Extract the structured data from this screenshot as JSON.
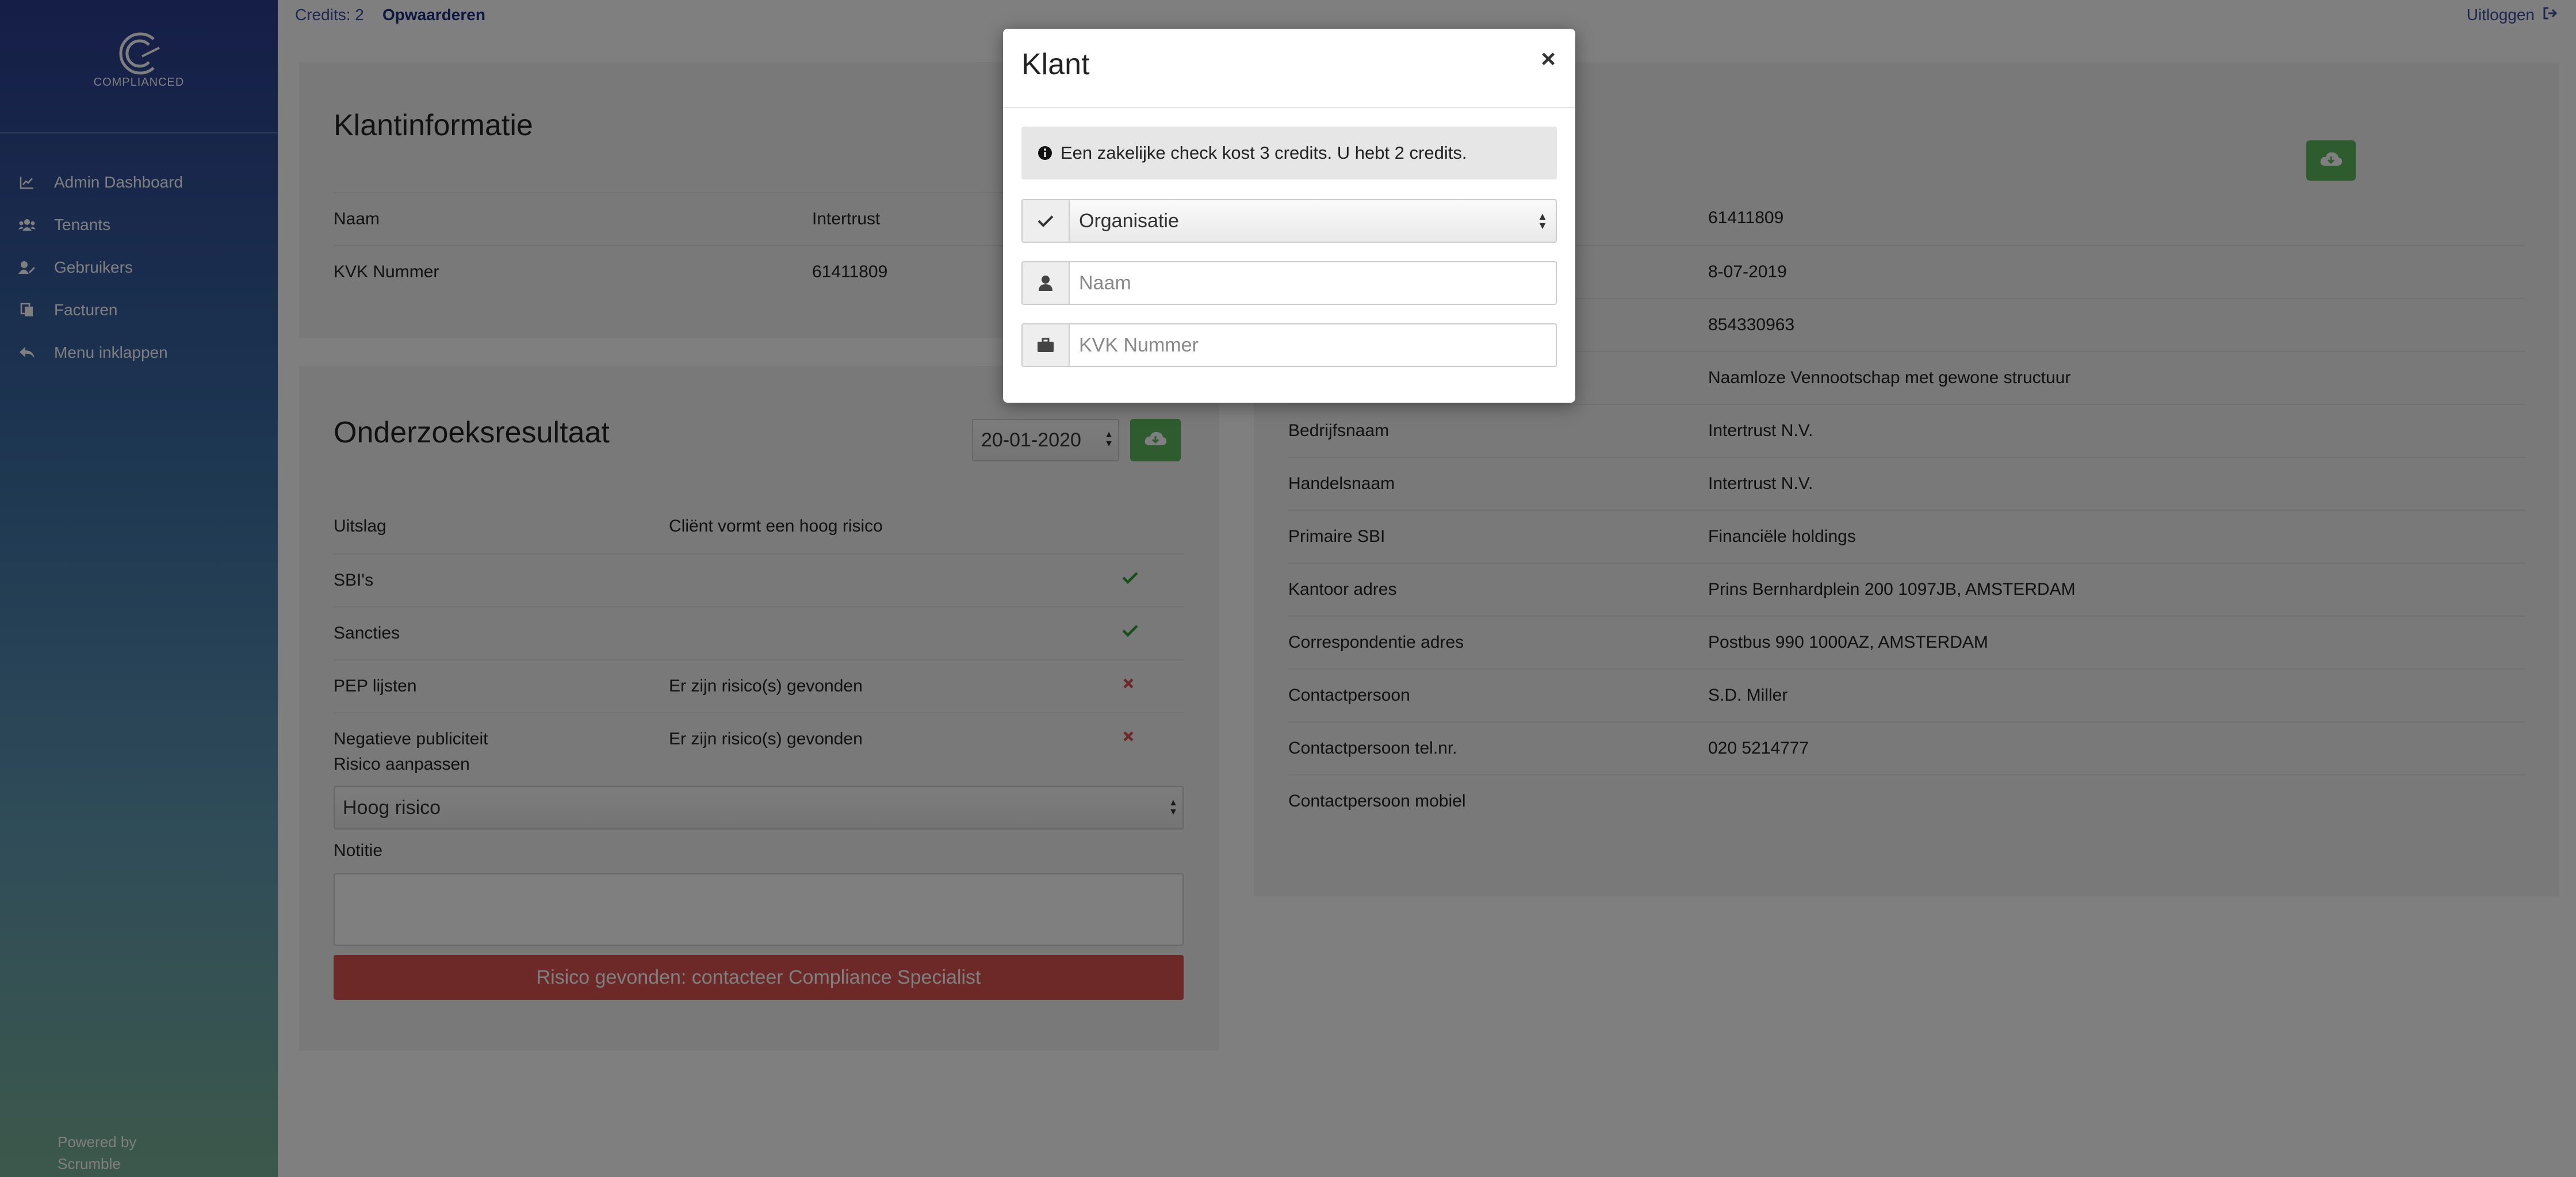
{
  "sidebar": {
    "logo_text": "COMPLIANCED",
    "items": [
      {
        "label": "Admin Dashboard",
        "icon": "chart-line-icon"
      },
      {
        "label": "Tenants",
        "icon": "users-icon"
      },
      {
        "label": "Gebruikers",
        "icon": "user-edit-icon"
      },
      {
        "label": "Facturen",
        "icon": "copy-icon"
      },
      {
        "label": "Menu inklappen",
        "icon": "reply-icon"
      }
    ],
    "powered_line1": "Powered by",
    "powered_line2": "Scrumble"
  },
  "topbar": {
    "credits": "Credits: 2",
    "topup": "Opwaarderen",
    "logout": "Uitloggen"
  },
  "klantinformatie": {
    "title": "Klantinformatie",
    "rows": [
      {
        "label": "Naam",
        "value": "Intertrust"
      },
      {
        "label": "KVK Nummer",
        "value": "61411809"
      }
    ]
  },
  "onderzoek": {
    "title": "Onderzoeksresultaat",
    "date": "20-01-2020",
    "rows": [
      {
        "label": "Uitslag",
        "value": "Cliënt vormt een hoog risico",
        "status": ""
      },
      {
        "label": "SBI's",
        "value": "",
        "status": "ok"
      },
      {
        "label": "Sancties",
        "value": "",
        "status": "ok"
      },
      {
        "label": "PEP lijsten",
        "value": "Er zijn risico(s) gevonden",
        "status": "risk"
      },
      {
        "label": "Negatieve publiciteit",
        "value": "Er zijn risico(s) gevonden",
        "status": "risk"
      }
    ],
    "risico_label": "Risico aanpassen",
    "risico_value": "Hoog risico",
    "notitie_label": "Notitie",
    "button": "Risico gevonden: contacteer Compliance Specialist"
  },
  "details": {
    "rows": [
      {
        "label": "",
        "value": "61411809"
      },
      {
        "label": "",
        "value": "8-07-2019"
      },
      {
        "label": "",
        "value": "854330963"
      },
      {
        "label": "",
        "value": "Naamloze Vennootschap met gewone structuur"
      },
      {
        "label": "Bedrijfsnaam",
        "value": "Intertrust N.V."
      },
      {
        "label": "Handelsnaam",
        "value": "Intertrust N.V."
      },
      {
        "label": "Primaire SBI",
        "value": "Financiële holdings"
      },
      {
        "label": "Kantoor adres",
        "value": "Prins Bernhardplein 200 1097JB, AMSTERDAM"
      },
      {
        "label": "Correspondentie adres",
        "value": "Postbus 990 1000AZ, AMSTERDAM"
      },
      {
        "label": "Contactpersoon",
        "value": "S.D. Miller"
      },
      {
        "label": "Contactpersoon tel.nr.",
        "value": "020 5214777"
      },
      {
        "label": "Contactpersoon mobiel",
        "value": ""
      }
    ]
  },
  "modal": {
    "title": "Klant",
    "close": "×",
    "alert": "Een zakelijke check kost 3 credits. U hebt 2 credits.",
    "type_value": "Organisatie",
    "name_placeholder": "Naam",
    "kvk_placeholder": "KVK Nummer"
  },
  "colors": {
    "sidebar_top": "#2a3c8e",
    "sidebar_bottom": "#79b197",
    "success": "#5cb85c",
    "danger": "#d9534f",
    "link": "#1c2f80"
  }
}
